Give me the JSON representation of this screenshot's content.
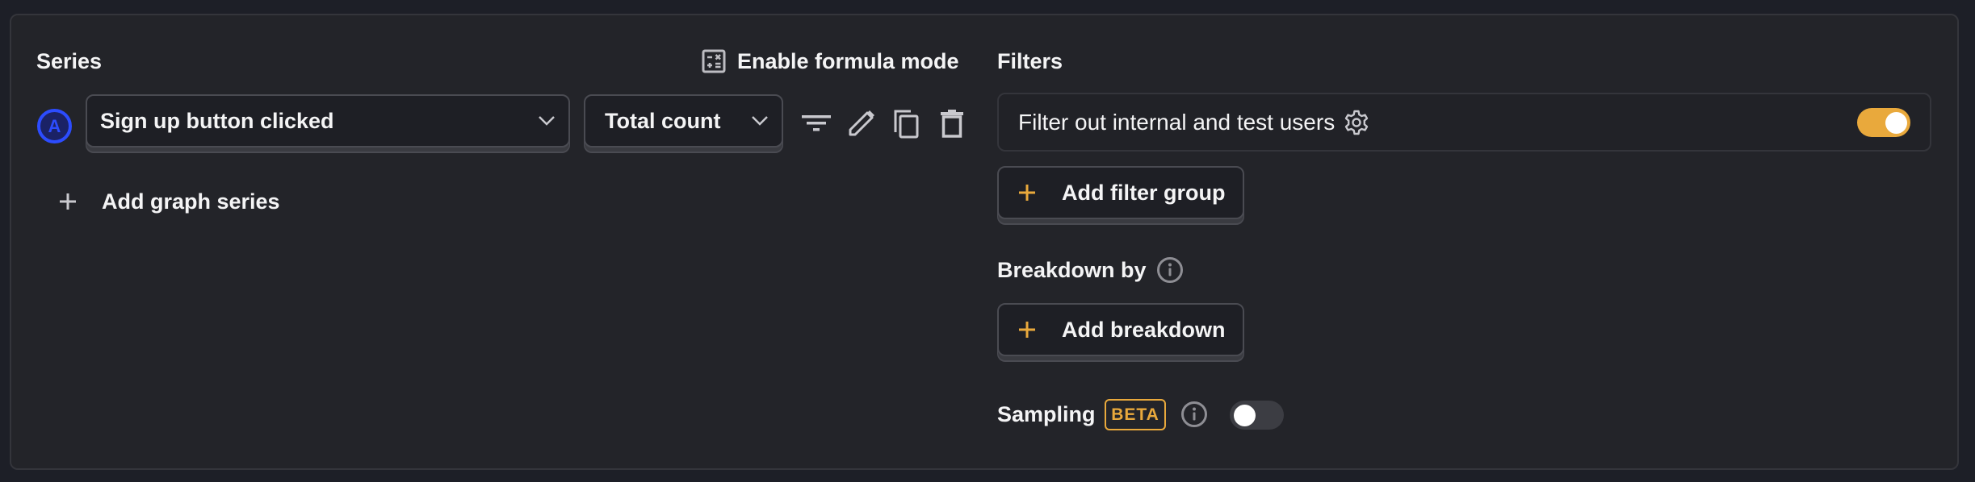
{
  "series_section": {
    "title": "Series",
    "formula_mode_label": "Enable formula mode",
    "formula_icon": "calculator-icon",
    "series": [
      {
        "badge": "A",
        "event": "Sign up button clicked",
        "aggregation": "Total count",
        "actions": [
          "filter-icon",
          "pencil-icon",
          "copy-icon",
          "trash-icon"
        ]
      }
    ],
    "add_series_label": "Add graph series"
  },
  "filters_section": {
    "title": "Filters",
    "test_filter": {
      "label": "Filter out internal and test users",
      "enabled": true
    },
    "add_filter_group_label": "Add filter group"
  },
  "breakdown_section": {
    "title": "Breakdown by",
    "add_breakdown_label": "Add breakdown"
  },
  "sampling_section": {
    "title": "Sampling",
    "badge": "BETA",
    "enabled": false
  },
  "colors": {
    "accent": "#e9a93c",
    "series_a": "#2c4cff",
    "background": "#232429"
  }
}
